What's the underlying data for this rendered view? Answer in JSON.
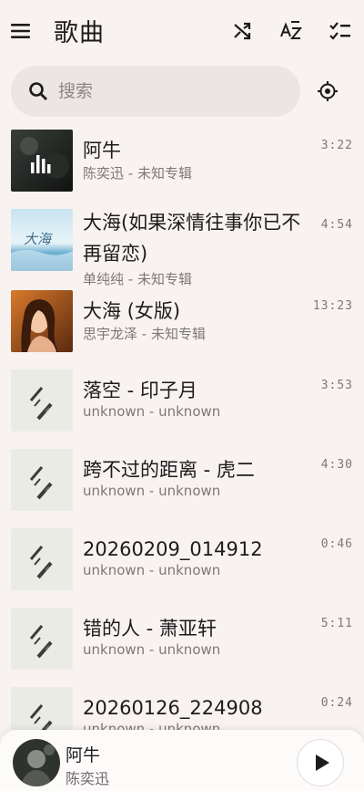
{
  "header": {
    "title": "歌曲",
    "icons": [
      "menu-icon",
      "shuffle-icon",
      "sort-az-icon",
      "multi-select-icon"
    ]
  },
  "search": {
    "placeholder": "搜索",
    "value": ""
  },
  "songs": [
    {
      "title": "阿牛",
      "subtitle": "陈奕迅 - 未知专辑",
      "duration": "3:22"
    },
    {
      "title": "大海(如果深情往事你已不再留恋)",
      "subtitle": "单纯纯 - 未知专辑",
      "duration": "4:54"
    },
    {
      "title": "大海 (女版)",
      "subtitle": "思宇龙泽 - 未知专辑",
      "duration": "13:23"
    },
    {
      "title": "落空 - 印子月",
      "subtitle": "unknown - unknown",
      "duration": "3:53"
    },
    {
      "title": "跨不过的距离 - 虎二",
      "subtitle": "unknown - unknown",
      "duration": "4:30"
    },
    {
      "title": "20260209_014912",
      "subtitle": "unknown - unknown",
      "duration": "0:46"
    },
    {
      "title": "错的人 - 萧亚轩",
      "subtitle": "unknown - unknown",
      "duration": "5:11"
    },
    {
      "title": "20260126_224908",
      "subtitle": "unknown - unknown",
      "duration": "0:24"
    }
  ],
  "cover_art_text": "大海",
  "now_playing": {
    "title": "阿牛",
    "artist": "陈奕迅"
  },
  "colors": {
    "background": "#f8f3f1",
    "search_bg": "#ebe5e3",
    "text_primary": "#1d1b1c",
    "text_secondary": "#7d7779"
  }
}
